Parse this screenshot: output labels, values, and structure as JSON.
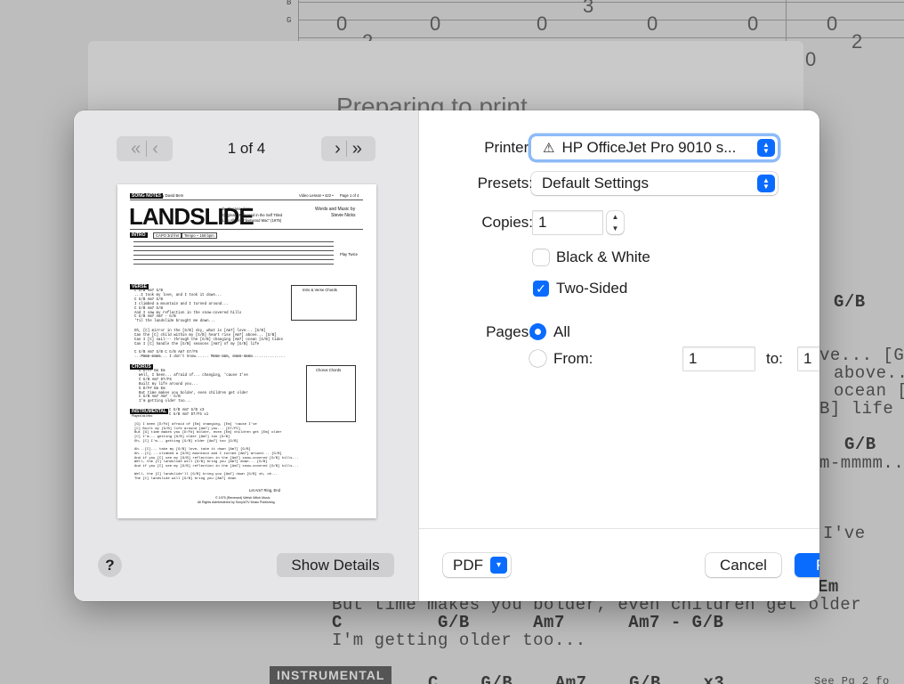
{
  "background_document": {
    "preparing_text": "Preparing to print",
    "tab_numbers": [
      "3",
      "0",
      "0",
      "0",
      "0",
      "2",
      "0",
      "0",
      "2",
      "0"
    ],
    "lines": [
      {
        "text": "G/B",
        "bold": true
      },
      {
        "text": "ve... [G/",
        "bold": false
      },
      {
        "text": "above...",
        "bold": false
      },
      {
        "text": "ocean [",
        "bold": false
      },
      {
        "text": "B] life",
        "bold": false
      },
      {
        "text": "G/B",
        "bold": true
      },
      {
        "text": "m-mmmm..",
        "bold": false
      },
      {
        "text": "I've",
        "bold": false
      },
      {
        "text": "Em",
        "bold": true
      },
      {
        "text": "But time makes you bolder, even children get older",
        "bold": false
      },
      {
        "text": "C         G/B      Am7      Am7 - G/B",
        "bold": true
      },
      {
        "text": "I'm getting older too...",
        "bold": false
      },
      {
        "text": "C    G/B    Am7    G/B    x3",
        "bold": true
      }
    ],
    "instrumental_tag": "INSTRUMENTAL",
    "side_note": "See Pg 2 fo"
  },
  "dialog": {
    "preview": {
      "page_indicator": "1 of 4",
      "song_notes_tag": "SONG NOTES",
      "byline": "by David Bern",
      "video_lesson": "Video Lesson • 422 •",
      "page": "Page 1 of 4",
      "title": "LANDSLIDE",
      "artist": "by Fleetwood Mac",
      "released": "Originally Released in the Self Titled",
      "album": "Live Album \"Fleetwood Mac\" (1975)",
      "credits": "Words and Music by",
      "writer": "Stevie Nicks",
      "intro_tag": "INTRO",
      "capo": "CAPO 3rd fret",
      "tempo": "Tempo ~ 159 bpm",
      "play_twice": "Play Twice",
      "verse_tag": "VERSE",
      "verse_chords_title": "Intro & Verse Chords",
      "chorus_tag": "CHORUS",
      "chorus_chords_title": "Chorus Chords",
      "instrumental_tag": "INSTRUMENTAL",
      "instrumental_sub": "Played as Intro",
      "verse_lines": [
        "C           G/B          Am7          G/B",
        "...I took my love, and I took it down...",
        "C           G/B          Am7          G/B",
        "I climbed a mountain and I turned around...",
        "C           G/B          Am7          G/B",
        "And I saw my reflection in the snow-covered hills",
        "      C          G/B         Am7     Am7 - G/B",
        "'Til the landslide brought me down..."
      ],
      "verse2_lines": [
        "Oh, [C] mirror in the [G/B] sky, what is [Am7] love... [G/B]",
        "Can the [C] child within my [G/B] heart rise [Am7] above... [G/B]",
        "Can I [C] sail--- through the [G/B] changing [Am7] ocean [G/B] tides",
        "Can I [C] handle the [G/B] seasons [Am7] of my [G/B] life"
      ],
      "verse3_lines": [
        "C       G/B       Am7       G/B       C       G/B       Am7       G7/F5",
        "...Mmmm-mmmm... I don't know...... Mmmm-mmm, mmmm-mmmm..............."
      ],
      "chorus_lines": [
        "       G         D/F#          Em         Em",
        "Well, I been... afraid of... changing, 'cause I've",
        "   C         G/B        Am7      D7/F5",
        "Built my life around you...",
        "      G          D/F#         Em          Em",
        "But time makes you bolder, even children get older",
        "C        G/B        Am7     Am7 - G/B",
        "I'm getting older too..."
      ],
      "instrumental_chords": "C    G/B    Am7    G/B    x3",
      "instrumental_chords2": "C    G/B    Am7    D7/F5    x1",
      "outro_lines": [
        "[G] I been [D/F#] afraid of [Em] changing, [Em] 'cause I've",
        "[C] Built my [G/B] life around [Am7] you... [D7/F5]",
        "But [G] time makes you [D/F#] bolder, even [Em] children get [Em] older",
        "[C] I'm--- getting [G/B] older [Am7] too [G/B]",
        "Oh, [C] I'm--- getting [G/B] older [Am7] too [G/B]",
        "",
        "Ah...[C]... take my [G/B] love, take it down [Am7] [G/B]",
        "Ah...[C]....climbed a [G/B] mountain and I turned [Am7] around... [G/B]",
        "And if you [C] see my [G/B] reflection in the [Am7] snow-covered [G/B] hills...",
        "Well, the [C] landslide will [G/B] bring you [Am7] down... [G/B]",
        "And if you [C] see my [G/B] reflection in the [Am7] snow-covered [G/B] hills...",
        "",
        "Well, the [C] landslide'll [G/B] bring you [Am7] down [G/B] oh, oh...",
        "The [C] landslide will [G/B] bring you [Am7] down"
      ],
      "ending_note": "Let Am7 Ring, End",
      "footer1": "© 1975 (Renewed) Welsh Witch Music",
      "footer2": "All Rights Administered by Sony/ATV Music Publishing"
    },
    "help_label": "?",
    "show_details_label": "Show Details",
    "printer": {
      "label": "Printer:",
      "value": "HP OfficeJet Pro 9010 s...",
      "warning_icon": "warning-triangle-icon"
    },
    "presets": {
      "label": "Presets:",
      "value": "Default Settings"
    },
    "copies": {
      "label": "Copies:",
      "value": "1"
    },
    "black_white": {
      "label": "Black & White",
      "checked": false
    },
    "two_sided": {
      "label": "Two-Sided",
      "checked": true
    },
    "pages": {
      "label": "Pages:",
      "all_label": "All",
      "from_label": "From:",
      "from_value": "1",
      "to_label": "to:",
      "to_value": "1",
      "selected": "all"
    },
    "pdf_label": "PDF",
    "cancel_label": "Cancel",
    "print_label": "Print",
    "accent_color": "#0a6cff"
  }
}
